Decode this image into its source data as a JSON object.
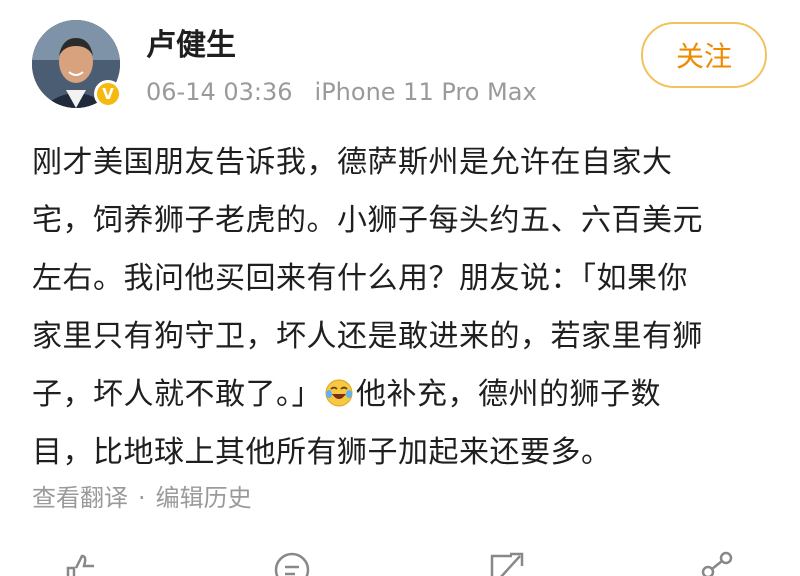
{
  "header": {
    "username": "卢健生",
    "date": "06-14 03:36",
    "device": "iPhone 11 Pro Max",
    "follow_label": "关注",
    "verified_badge": "V"
  },
  "post": {
    "lines": [
      "刚才美国朋友告诉我，德萨斯州是允许在自家大",
      "宅，饲养狮子老虎的。小狮子每头约五、六百美元",
      "左右。我问他买回来有什么用？朋友说：「如果你",
      "家里只有狗守卫，坏人还是敢进来的，若家里有狮",
      "子，坏人就不敢了。」",
      "他补充，德州的狮子数",
      "目，比地球上其他所有狮子加起来还要多。"
    ],
    "emoji": "laughing-crying-emoji"
  },
  "footer_links": {
    "translate": "查看翻译",
    "separator": "·",
    "edit_history": "编辑历史"
  },
  "bottom_bar": {
    "icons": [
      "like-icon",
      "comment-icon",
      "repost-icon",
      "share-icon"
    ]
  },
  "colors": {
    "accent": "#f08b00",
    "follow_border": "#f3c25e",
    "badge": "#f5b90f",
    "muted": "#9a9a9a"
  }
}
